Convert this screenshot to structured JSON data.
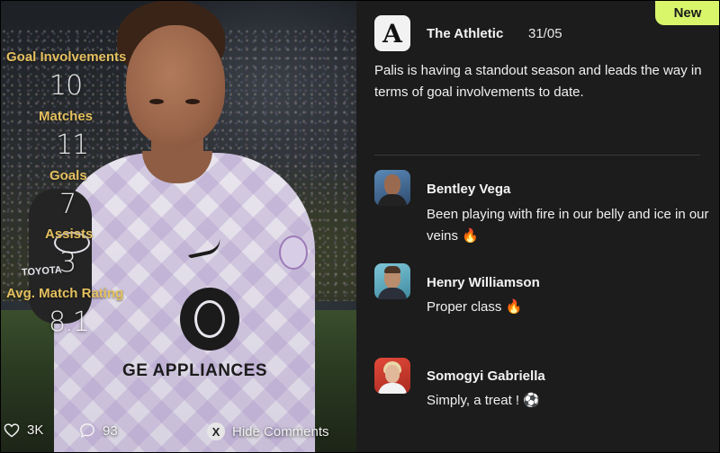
{
  "stats": [
    {
      "label": "Goal Involvements",
      "value": "10"
    },
    {
      "label": "Matches",
      "value": "11"
    },
    {
      "label": "Goals",
      "value": "7"
    },
    {
      "label": "Assists",
      "value": "3"
    },
    {
      "label": "Avg. Match Rating",
      "value": "8.1"
    }
  ],
  "jersey": {
    "sponsor": "GE APPLIANCES",
    "sleeve_sponsor": "TOYOTA"
  },
  "bottom_bar": {
    "likes": "3K",
    "comments": "93",
    "hide_button_glyph": "X",
    "hide_label": "Hide Comments"
  },
  "post": {
    "badge": "New",
    "source_logo_letter": "A",
    "source": "The Athletic",
    "date": "31/05",
    "text": "Palis is having a standout season and leads the way in terms of goal involvements to date."
  },
  "comments": [
    {
      "author": "Bentley Vega",
      "text": "Been playing with fire in our belly and ice in our veins 🔥"
    },
    {
      "author": "Henry Williamson",
      "text": "Proper class 🔥"
    },
    {
      "author": "Somogyi Gabriella",
      "text": "Simply, a treat ! ⚽"
    }
  ],
  "colors": {
    "accent": "#d9f56a",
    "stat_label": "#e5c05f",
    "panel_bg": "#1c1c1c"
  },
  "icons": {
    "likes": "heart-icon",
    "comments": "speech-bubble-icon",
    "hide": "x-button-icon",
    "source": "the-athletic-logo-icon"
  }
}
